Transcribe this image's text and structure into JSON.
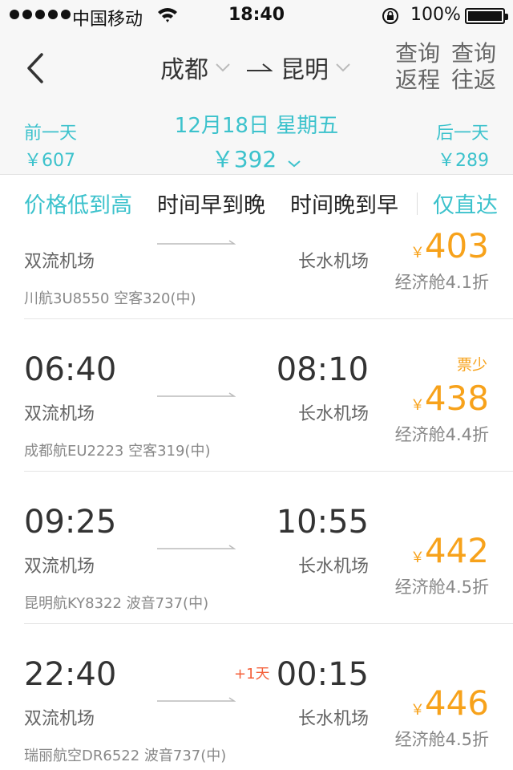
{
  "status_bar": {
    "carrier": "中国移动",
    "time": "18:40",
    "battery": "100%"
  },
  "header": {
    "from_city": "成都",
    "to_city": "昆明",
    "query_return_line1": "查询",
    "query_return_line2": "返程",
    "query_round_line1": "查询",
    "query_round_line2": "往返"
  },
  "date_bar": {
    "prev_label": "前一天",
    "prev_price": "￥607",
    "current_date": "12月18日 星期五",
    "current_price": "￥392",
    "next_label": "后一天",
    "next_price": "￥289"
  },
  "sort": {
    "price_low_high": "价格低到高",
    "time_early_late": "时间早到晚",
    "time_late_early": "时间晚到早",
    "direct_only": "仅直达"
  },
  "flights": [
    {
      "dep_airport": "双流机场",
      "arr_airport": "长水机场",
      "currency": "￥",
      "price": "403",
      "cabin": "经济舱4.1折",
      "info": "川航3U8550 空客320(中)"
    },
    {
      "dep_time": "06:40",
      "arr_time": "08:10",
      "dep_airport": "双流机场",
      "arr_airport": "长水机场",
      "badge": "票少",
      "currency": "￥",
      "price": "438",
      "cabin": "经济舱4.4折",
      "info": "成都航EU2223 空客319(中)"
    },
    {
      "dep_time": "09:25",
      "arr_time": "10:55",
      "dep_airport": "双流机场",
      "arr_airport": "长水机场",
      "currency": "￥",
      "price": "442",
      "cabin": "经济舱4.5折",
      "info": "昆明航KY8322 波音737(中)"
    },
    {
      "dep_time": "22:40",
      "arr_time": "00:15",
      "plus_day": "+1天",
      "dep_airport": "双流机场",
      "arr_airport": "长水机场",
      "currency": "￥",
      "price": "446",
      "cabin": "经济舱4.5折",
      "info": "瑞丽航空DR6522 波音737(中)"
    }
  ],
  "colors": {
    "accent": "#3cc2cc",
    "price": "#f7a21b",
    "plus_day": "#f4603a"
  }
}
